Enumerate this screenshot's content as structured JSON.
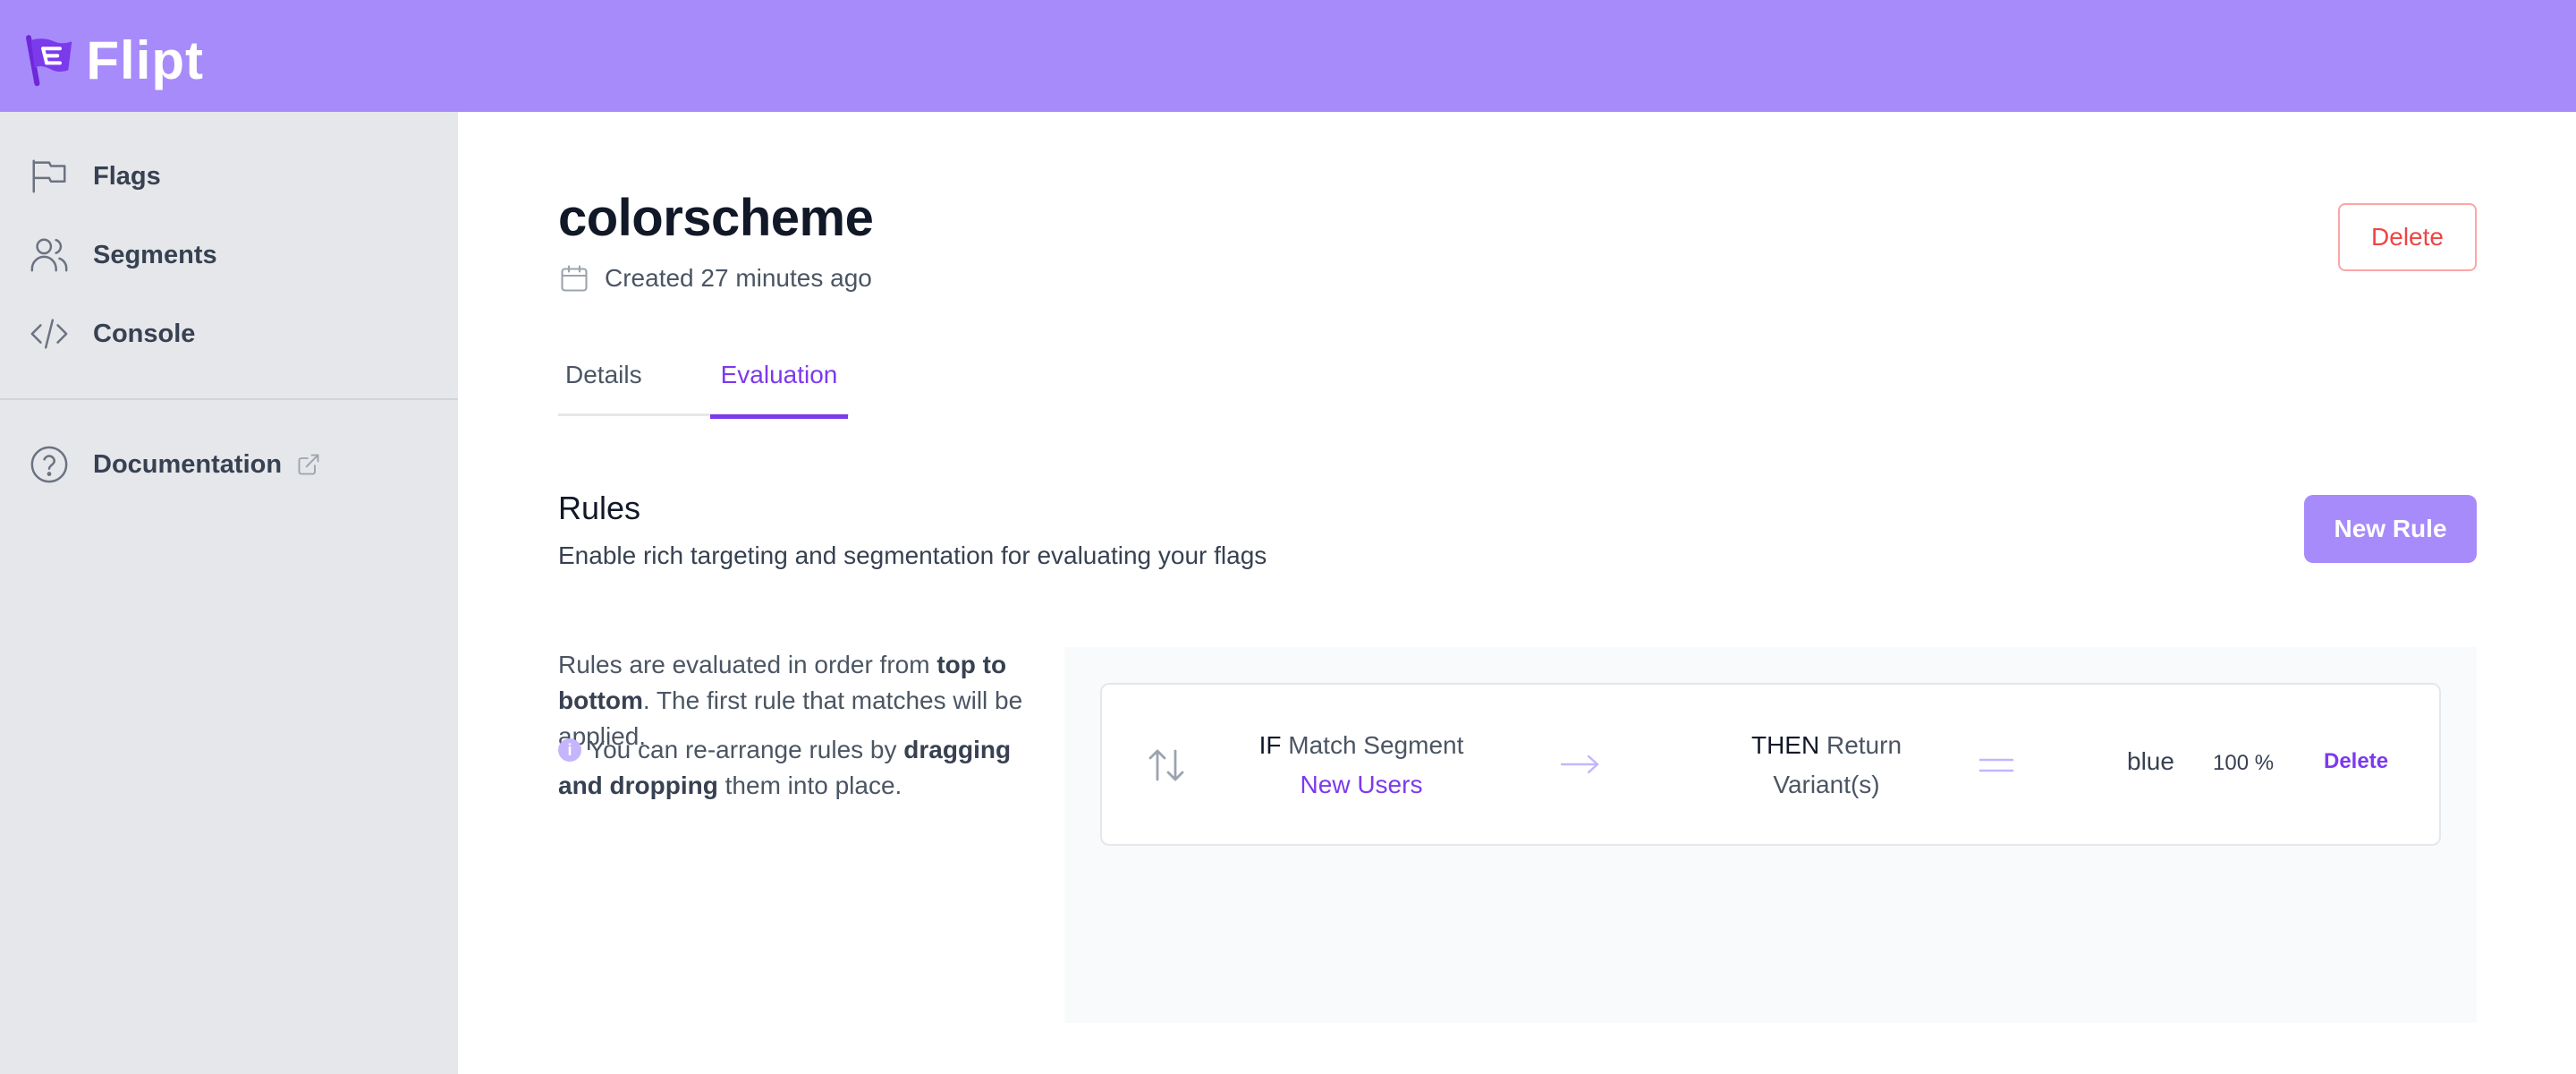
{
  "app": {
    "name": "Flipt",
    "brand_color": "#a78bfa",
    "accent_color": "#7c3aed"
  },
  "sidebar": {
    "items": [
      {
        "label": "Flags",
        "icon": "flag-icon"
      },
      {
        "label": "Segments",
        "icon": "users-icon"
      },
      {
        "label": "Console",
        "icon": "code-icon"
      }
    ],
    "documentation": {
      "label": "Documentation",
      "icon": "question-circle-icon",
      "external_icon": "external-link-icon"
    }
  },
  "flag": {
    "name": "colorscheme",
    "created": "Created 27 minutes ago",
    "delete_label": "Delete"
  },
  "tabs": [
    {
      "label": "Details",
      "active": false
    },
    {
      "label": "Evaluation",
      "active": true
    }
  ],
  "rules": {
    "heading": "Rules",
    "subheading": "Enable rich targeting and segmentation for evaluating your flags",
    "new_rule_label": "New Rule",
    "help_order": {
      "prefix": "Rules are evaluated in order from ",
      "bold": "top to bottom",
      "suffix": ". The first rule that matches will be applied."
    },
    "help_drag": {
      "prefix": "You can re-arrange rules by ",
      "bold": "dragging and dropping",
      "suffix": " them into place."
    },
    "items": [
      {
        "if_keyword": "IF",
        "if_label": "Match Segment",
        "segment": "New Users",
        "then_keyword": "THEN",
        "then_label": "Return Variant(s)",
        "variant": "blue",
        "distribution": "100 %",
        "delete_label": "Delete"
      }
    ]
  }
}
